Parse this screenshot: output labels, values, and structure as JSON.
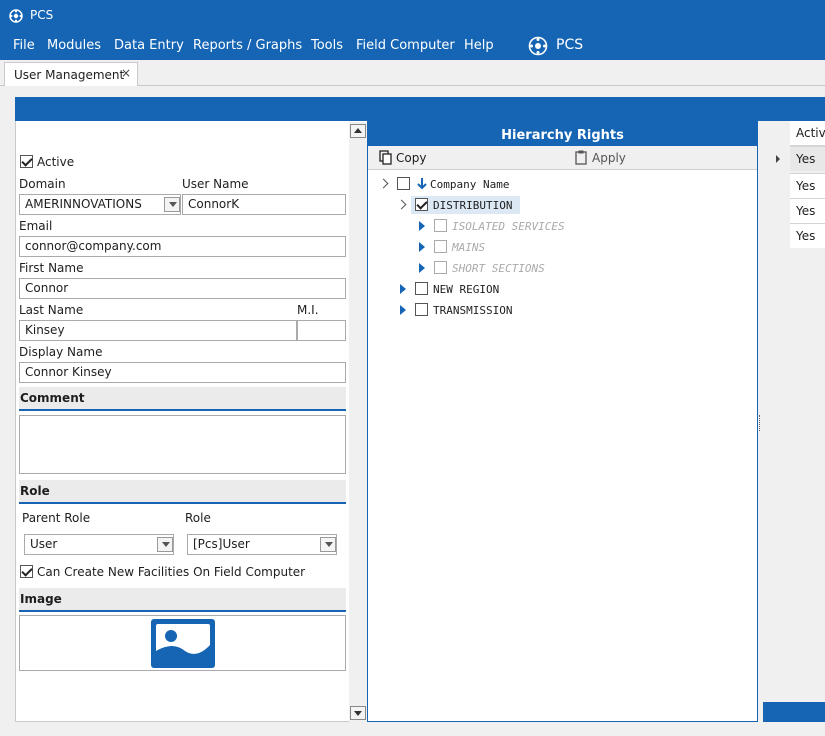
{
  "app": {
    "title": "PCS",
    "brand": "PCS"
  },
  "menu": [
    "File",
    "Modules",
    "Data Entry",
    "Reports / Graphs",
    "Tools",
    "Field Computer",
    "Help"
  ],
  "tab": {
    "label": "User Management",
    "close": "×"
  },
  "form": {
    "active_label": "Active",
    "active_checked": true,
    "domain_label": "Domain",
    "domain_value": "AMERINNOVATIONS",
    "username_label": "User Name",
    "username_value": "ConnorK",
    "email_label": "Email",
    "email_value": "connor@company.com",
    "firstname_label": "First Name",
    "firstname_value": "Connor",
    "lastname_label": "Last Name",
    "lastname_value": "Kinsey",
    "mi_label": "M.I.",
    "mi_value": "",
    "displayname_label": "Display Name",
    "displayname_value": "Connor Kinsey",
    "comment_header": "Comment",
    "comment_value": "",
    "role_header": "Role",
    "parent_role_label": "Parent Role",
    "parent_role_value": "User",
    "role_label": "Role",
    "role_value": "[Pcs]User",
    "create_facilities_label": "Can Create New Facilities On Field Computer",
    "create_facilities_checked": true,
    "image_header": "Image"
  },
  "hierarchy": {
    "title": "Hierarchy Rights",
    "copy_label": "Copy",
    "apply_label": "Apply",
    "nodes": {
      "root": "Company Name",
      "distribution": "DISTRIBUTION",
      "isolated": "ISOLATED SERVICES",
      "mains": "MAINS",
      "short": "SHORT SECTIONS",
      "new_region": "NEW REGION",
      "transmission": "TRANSMISSION"
    }
  },
  "grid": {
    "header": "Active",
    "rows": [
      "Yes",
      "Yes",
      "Yes",
      "Yes"
    ]
  },
  "colors": {
    "accent": "#1565b4",
    "panel": "#f0f0f0"
  }
}
